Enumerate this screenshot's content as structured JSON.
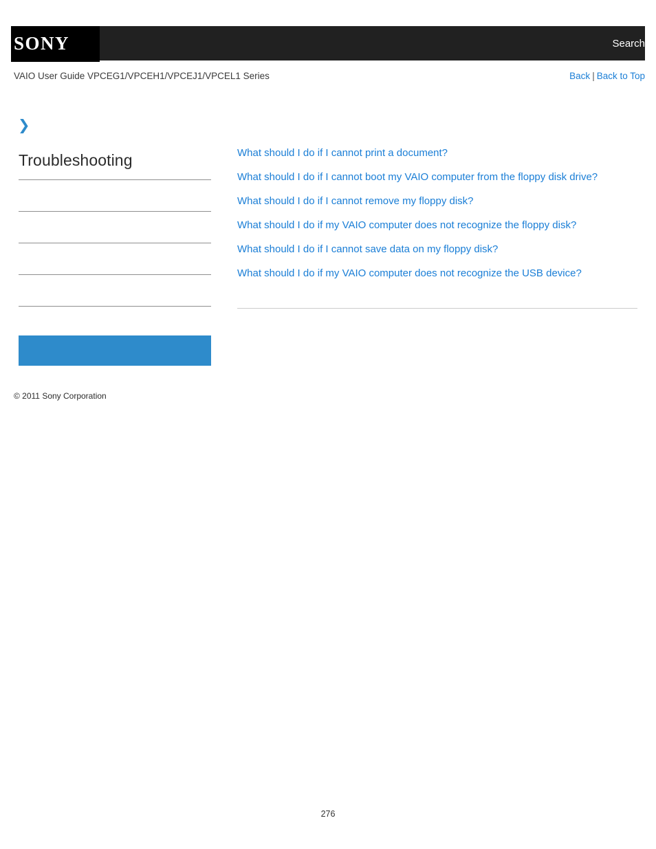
{
  "header": {
    "logo_text": "SONY",
    "search_label": "Search",
    "logo_icon": "sony-logo"
  },
  "subheader": {
    "guide_title": "VAIO User Guide VPCEG1/VPCEH1/VPCEJ1/VPCEL1 Series",
    "back_label": "Back",
    "separator": "|",
    "back_to_top_label": "Back to Top"
  },
  "sidebar": {
    "chevron_icon": "chevron-right-icon",
    "chevron_glyph": "❯",
    "section_title": "Troubleshooting",
    "copyright": "© 2011 Sony Corporation"
  },
  "content": {
    "links": [
      "What should I do if I cannot print a document?",
      "What should I do if I cannot boot my VAIO computer from the floppy disk drive?",
      "What should I do if I cannot remove my floppy disk?",
      "What should I do if my VAIO computer does not recognize the floppy disk?",
      "What should I do if I cannot save data on my floppy disk?",
      "What should I do if my VAIO computer does not recognize the USB device?"
    ]
  },
  "footer": {
    "page_number": "276"
  },
  "colors": {
    "header_bg": "#212121",
    "logo_bg": "#000000",
    "link_blue": "#1a7ed6",
    "accent_blue": "#2e8bcb",
    "rule_gray": "#8e8e8e"
  }
}
